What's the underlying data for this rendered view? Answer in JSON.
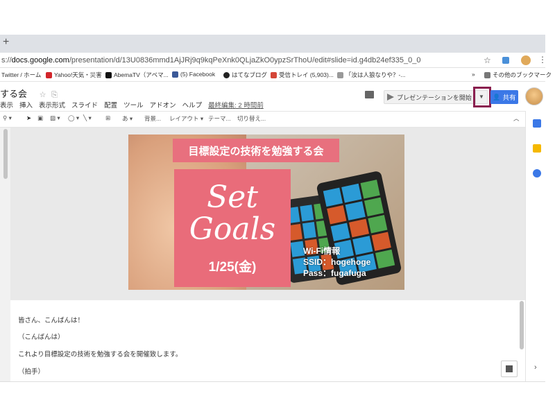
{
  "browser": {
    "new_tab": "+",
    "url_prefix": "s://",
    "url_domain": "docs.google.com",
    "url_path": "/presentation/d/13U0836mmd1AjJRj9q9kqPeXnk0QLjaZkO0ypzSrThoU/edit#slide=id.g4db24ef335_0_0",
    "bookmarks": [
      {
        "label": "Twitter / ホーム",
        "color": "#ffffff"
      },
      {
        "label": "Yahoo!天気・災害",
        "color": "#d2252b"
      },
      {
        "label": "AbemaTV（アベマ...",
        "color": "#111111"
      },
      {
        "label": "(5) Facebook",
        "color": "#3b5998"
      },
      {
        "label": "はてなブログ",
        "color": "#222222"
      },
      {
        "label": "受信トレイ (5,903)...",
        "color": "#d44638"
      },
      {
        "label": "「汝は人狼なりや？-...",
        "color": "#999999"
      }
    ],
    "other_bookmarks": "その他のブックマーク"
  },
  "app": {
    "title": "する会",
    "menu": [
      "表示",
      "挿入",
      "表示形式",
      "スライド",
      "配置",
      "ツール",
      "アドオン",
      "ヘルプ"
    ],
    "last_edit": "最終編集: 2 時間前",
    "present_label": "プレゼンテーションを開始",
    "share_label": "共有"
  },
  "toolbar": {
    "background": "背景...",
    "layout": "レイアウト",
    "theme": "テーマ...",
    "transition": "切り替え..."
  },
  "slide": {
    "banner": "目標設定の技術を勉強する会",
    "line1": "Set",
    "line2": "Goals",
    "date": "1/25(金)",
    "wifi_title": "Wi-Fi情報",
    "ssid": "SSID：hogehoge",
    "pass": "Pass：fugafuga",
    "accent": "#e96c7a"
  },
  "notes": [
    "皆さん、こんばんは！",
    "（こんばんは）",
    "これより目標設定の技術を勉強する会を開催致します。",
    "（拍手）"
  ],
  "colors": {
    "share_blue": "#3b78e7",
    "highlight_frame": "#8a1f4f"
  }
}
